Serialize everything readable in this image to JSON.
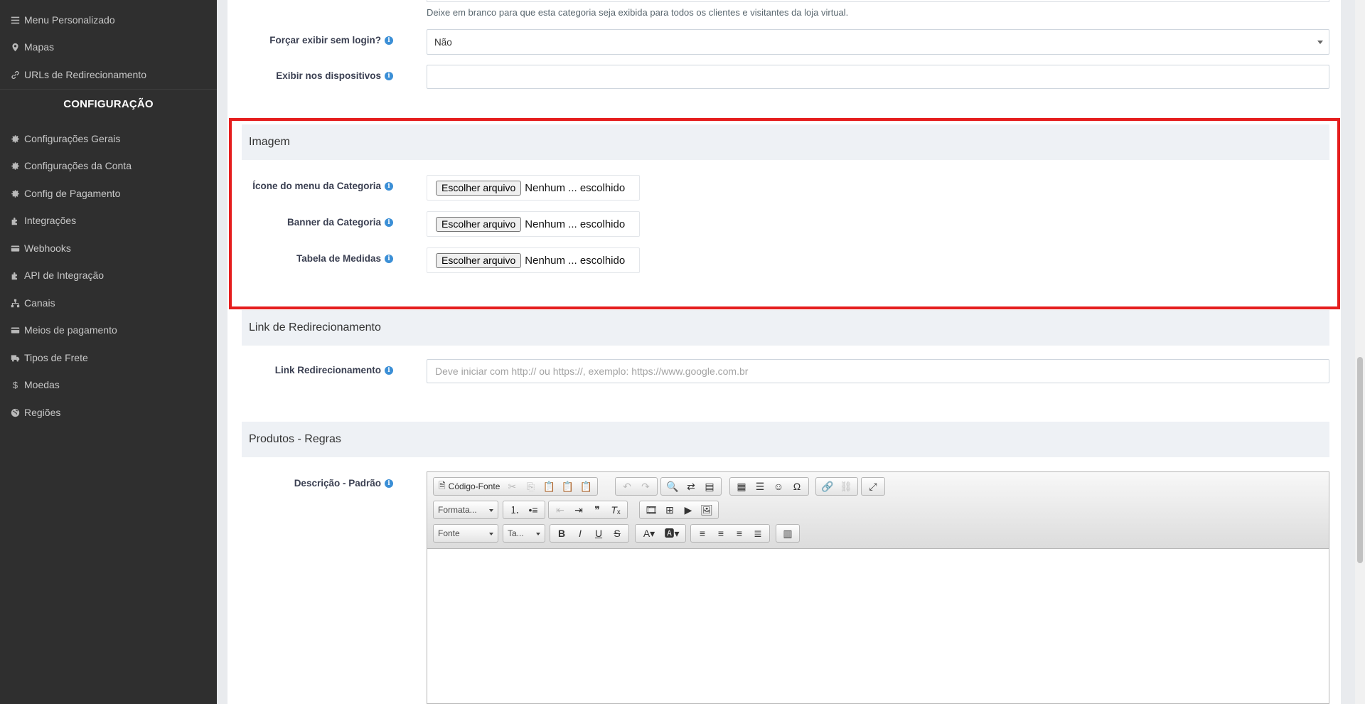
{
  "sidebar": {
    "items_top": [
      {
        "label": "Menu Personalizado",
        "icon": "list-icon"
      },
      {
        "label": "Mapas",
        "icon": "map-marker-icon"
      },
      {
        "label": "URLs de Redirecionamento",
        "icon": "link-icon"
      }
    ],
    "section_title": "CONFIGURAÇÃO",
    "items": [
      {
        "label": "Configurações Gerais",
        "icon": "gear-icon"
      },
      {
        "label": "Configurações da Conta",
        "icon": "gear-icon"
      },
      {
        "label": "Config de Pagamento",
        "icon": "gear-icon"
      },
      {
        "label": "Integrações",
        "icon": "puzzle-icon"
      },
      {
        "label": "Webhooks",
        "icon": "credit-card-icon"
      },
      {
        "label": "API de Integração",
        "icon": "puzzle-icon"
      },
      {
        "label": "Canais",
        "icon": "sitemap-icon"
      },
      {
        "label": "Meios de pagamento",
        "icon": "credit-card-icon"
      },
      {
        "label": "Tipos de Frete",
        "icon": "truck-icon"
      },
      {
        "label": "Moedas",
        "icon": "dollar-icon"
      },
      {
        "label": "Regiões",
        "icon": "globe-icon"
      }
    ]
  },
  "form": {
    "clients_help": "Deixe em branco para que esta categoria seja exibida para todos os clientes e visitantes da loja virtual.",
    "force_login": {
      "label": "Forçar exibir sem login?",
      "value": "Não"
    },
    "devices": {
      "label": "Exibir nos dispositivos",
      "value": ""
    },
    "image_section": {
      "title": "Imagem",
      "fields": [
        {
          "label": "Ícone do menu da Categoria",
          "button": "Escolher arquivo",
          "status": "Nenhum ... escolhido"
        },
        {
          "label": "Banner da Categoria",
          "button": "Escolher arquivo",
          "status": "Nenhum ... escolhido"
        },
        {
          "label": "Tabela de Medidas",
          "button": "Escolher arquivo",
          "status": "Nenhum ... escolhido"
        }
      ]
    },
    "redirect_section": {
      "title": "Link de Redirecionamento",
      "label": "Link Redirecionamento",
      "placeholder": "Deve iniciar com http:// ou https://, exemplo: https://www.google.com.br"
    },
    "rules_section": {
      "title": "Produtos - Regras",
      "label": "Descrição - Padrão"
    }
  },
  "editor": {
    "source_label": "Código-Fonte",
    "format_label": "Formata...",
    "font_label": "Fonte",
    "size_label": "Ta...",
    "colors": {
      "accent": "#3b8fd6",
      "highlight": "#e51e1e",
      "sidebar": "#2f2f2f"
    }
  }
}
